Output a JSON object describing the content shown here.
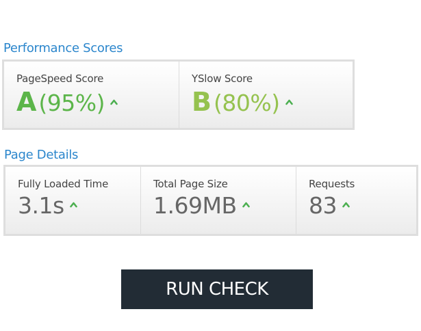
{
  "colors": {
    "title": "#2b86cc",
    "grade_a": "#5cb54a",
    "grade_b": "#95c24f",
    "arrow_up": "#4caf50",
    "button_bg": "#222c35"
  },
  "performance": {
    "title": "Performance Scores",
    "pagespeed": {
      "label": "PageSpeed Score",
      "grade": "A",
      "percent": "(95%)",
      "trend_icon": "up-arrow-icon"
    },
    "yslow": {
      "label": "YSlow Score",
      "grade": "B",
      "percent": "(80%)",
      "trend_icon": "up-arrow-icon"
    }
  },
  "details": {
    "title": "Page Details",
    "load_time": {
      "label": "Fully Loaded Time",
      "value": "3.1s",
      "trend_icon": "up-arrow-icon"
    },
    "page_size": {
      "label": "Total Page Size",
      "value": "1.69MB",
      "trend_icon": "up-arrow-icon"
    },
    "requests": {
      "label": "Requests",
      "value": "83",
      "trend_icon": "up-arrow-icon"
    }
  },
  "action": {
    "run_label": "RUN CHECK"
  }
}
